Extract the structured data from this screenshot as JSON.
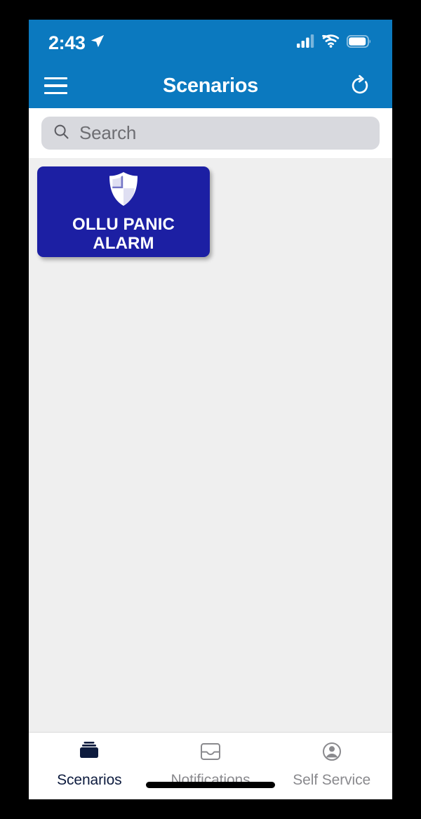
{
  "status_bar": {
    "time": "2:43",
    "location_icon": "location-arrow-icon",
    "cellular_icon": "cellular-signal-icon",
    "wifi_icon": "wifi-icon",
    "battery_icon": "battery-icon"
  },
  "nav_bar": {
    "menu_icon": "hamburger-menu-icon",
    "title": "Scenarios",
    "refresh_icon": "refresh-icon"
  },
  "search": {
    "icon": "search-icon",
    "placeholder": "Search",
    "value": ""
  },
  "content": {
    "tiles": [
      {
        "label": "OLLU PANIC ALARM",
        "icon": "shield-icon",
        "color": "#1c1fa3"
      }
    ]
  },
  "tab_bar": {
    "tabs": [
      {
        "label": "Scenarios",
        "icon": "stacked-cards-icon",
        "active": true
      },
      {
        "label": "Notifications",
        "icon": "inbox-icon",
        "active": false
      },
      {
        "label": "Self Service",
        "icon": "account-circle-icon",
        "active": false
      }
    ]
  },
  "colors": {
    "header_blue": "#0b79bf",
    "tile_blue": "#1c1fa3",
    "content_gray": "#efefef",
    "search_gray": "#d8d9de",
    "active_tab": "#0d1b3e",
    "inactive_tab": "#8a8a8e"
  }
}
